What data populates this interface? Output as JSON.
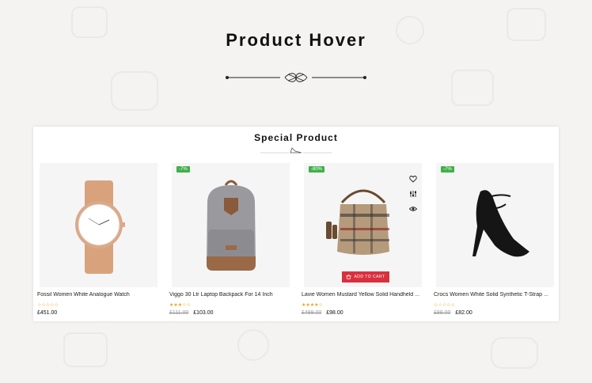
{
  "hero": {
    "title": "Product Hover"
  },
  "section": {
    "title": "Special Product"
  },
  "products": [
    {
      "name": "Fossil Women White Analogue Watch",
      "badge": "",
      "stars": "☆☆☆☆☆",
      "old_price": "",
      "price": "£451.00"
    },
    {
      "name": "Viggo 30 Ltr Laptop Backpack For 14 Inch",
      "badge": "-7%",
      "stars": "★★★☆☆",
      "old_price": "£111.00",
      "price": "£103.00"
    },
    {
      "name": "Lavie Women Mustard Yellow Solid Handheld ...",
      "badge": "-80%",
      "stars": "★★★★☆",
      "old_price": "£489.00",
      "price": "£98.00"
    },
    {
      "name": "Crocs Women White Solid Synthetic T-Strap ...",
      "badge": "-7%",
      "stars": "☆☆☆☆☆",
      "old_price": "£88.00",
      "price": "£82.00"
    }
  ],
  "hover_actions": {
    "add_to_cart_label": "ADD TO CART"
  },
  "colors": {
    "badge": "#3fb04a",
    "add_to_cart": "#d9303e",
    "stars": "#e8a317"
  },
  "icons": [
    "heart-icon",
    "compare-icon",
    "eye-icon",
    "cart-icon"
  ]
}
